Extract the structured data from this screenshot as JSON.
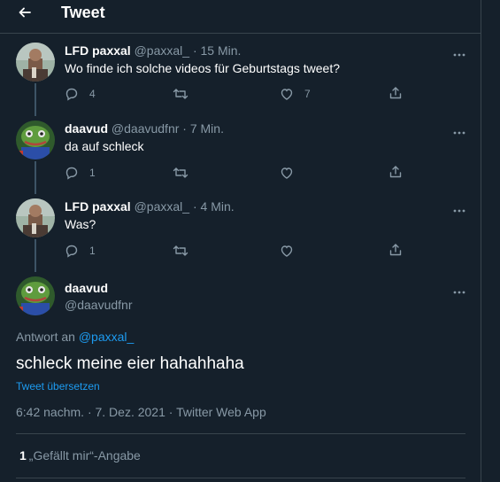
{
  "header": {
    "title": "Tweet"
  },
  "tweets": [
    {
      "name": "LFD paxxal",
      "handle": "@paxxal_",
      "time": "15 Min.",
      "text": "Wo finde ich solche videos für Geburtstags tweet?",
      "replies": "4",
      "retweets": "",
      "likes": "7"
    },
    {
      "name": "daavud",
      "handle": "@daavudfnr",
      "time": "7 Min.",
      "text": "da auf schleck",
      "replies": "1",
      "retweets": "",
      "likes": ""
    },
    {
      "name": "LFD paxxal",
      "handle": "@paxxal_",
      "time": "4 Min.",
      "text": "Was?",
      "replies": "1",
      "retweets": "",
      "likes": ""
    }
  ],
  "main_tweet": {
    "name": "daavud",
    "handle": "@daavudfnr",
    "reply_prefix": "Antwort an",
    "reply_to": "@paxxal_",
    "text": "schleck meine eier hahahhaha",
    "translate": "Tweet übersetzen",
    "timestamp": "6:42 nachm. · 7. Dez. 2021 · Twitter Web App",
    "likes_count": "1",
    "likes_label": "„Gefällt mir“-Angabe"
  },
  "dot": "·",
  "icons": {
    "back": "arrow-left-icon",
    "reply": "reply-icon",
    "retweet": "retweet-icon",
    "like": "heart-icon",
    "share": "share-icon",
    "more": "more-icon"
  },
  "colors": {
    "background": "#15202b",
    "border": "#38444d",
    "secondary_text": "#8899a6",
    "link": "#1d9bf0"
  }
}
